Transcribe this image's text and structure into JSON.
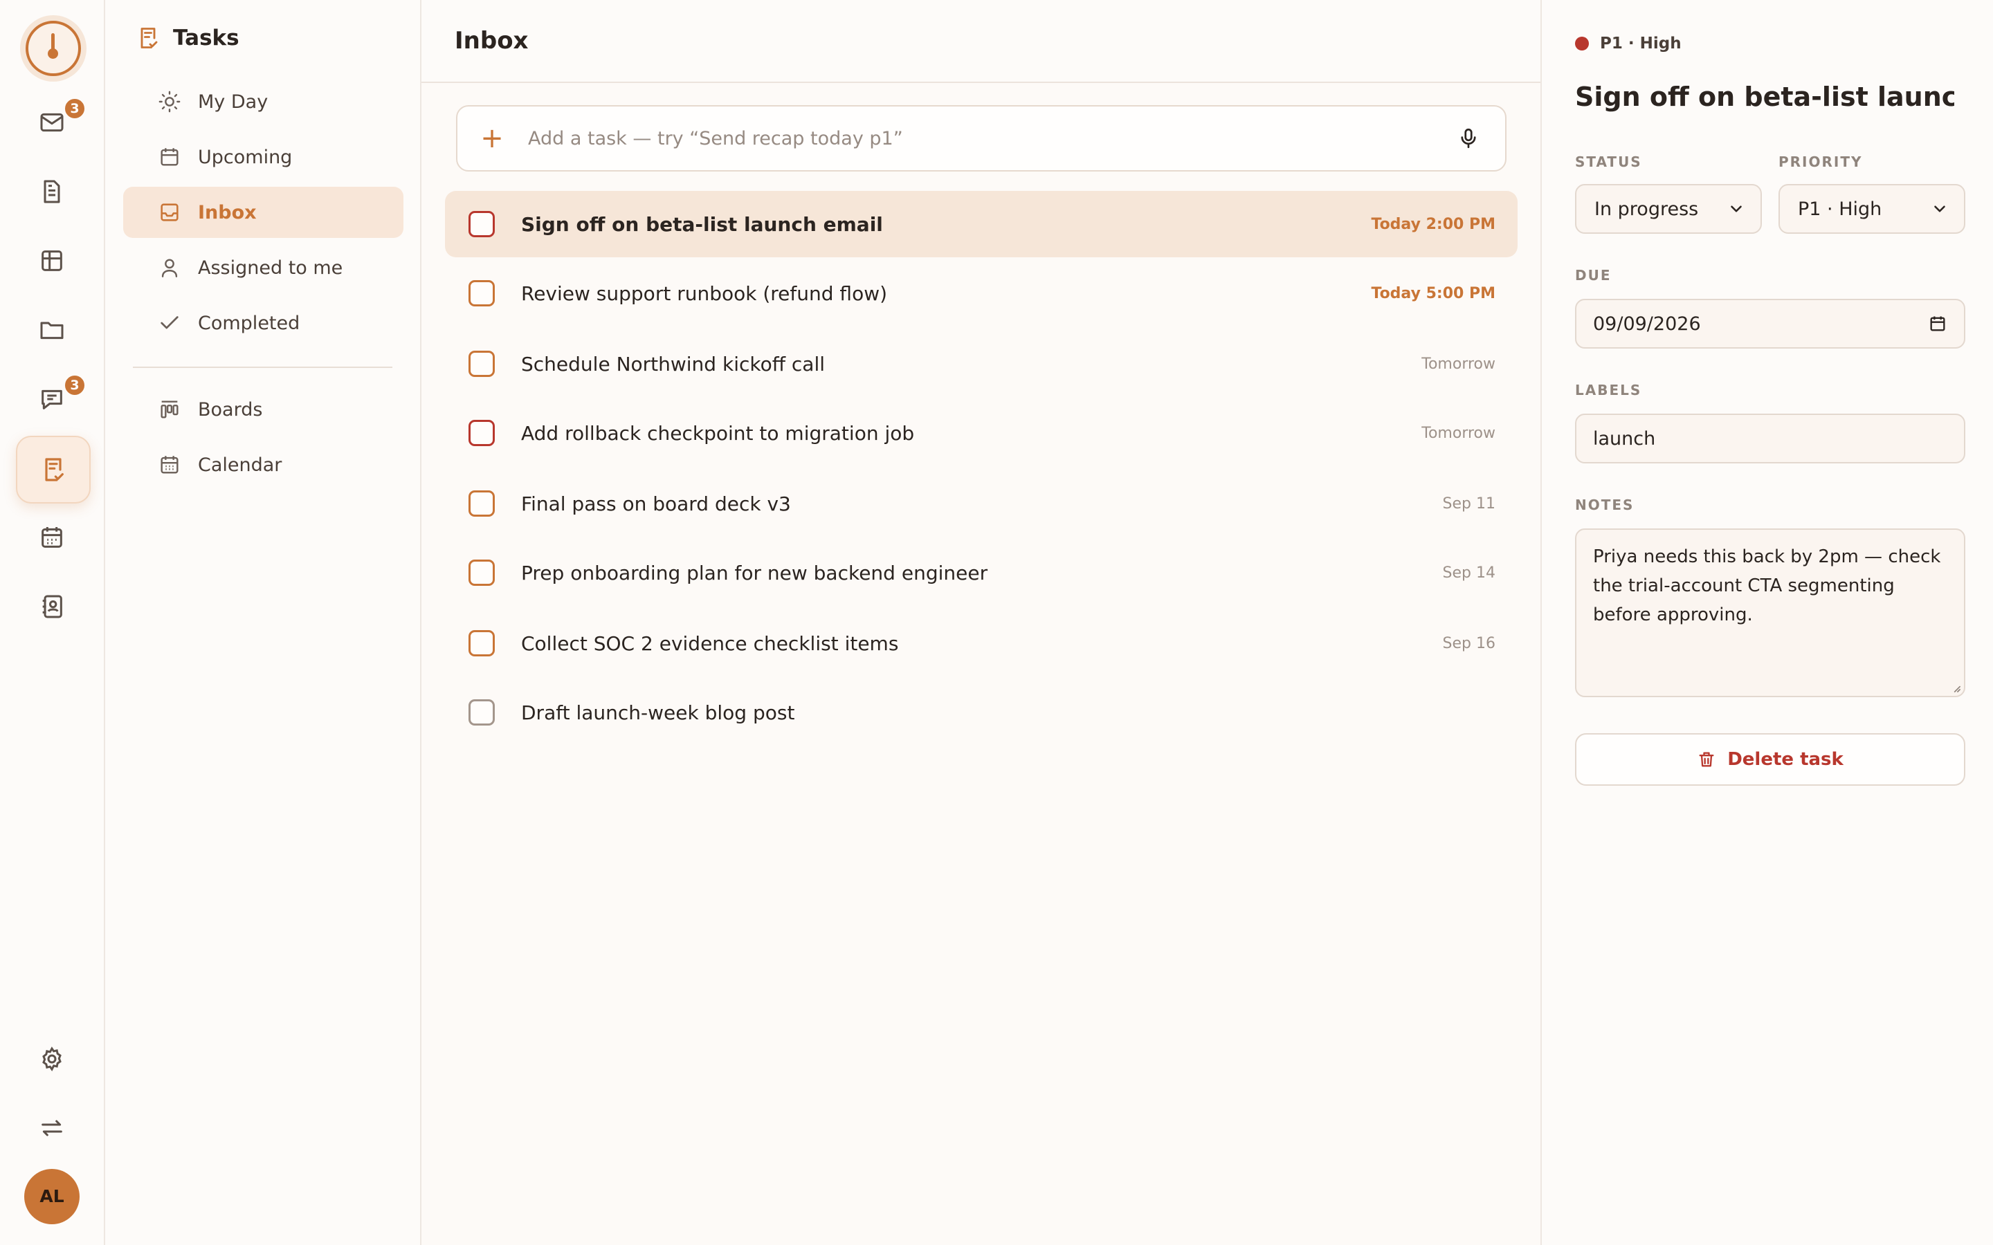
{
  "rail": {
    "badges": {
      "mail": "3",
      "chat": "3"
    },
    "avatar_initials": "AL"
  },
  "nav": {
    "title": "Tasks",
    "items": [
      {
        "label": "My Day",
        "icon": "sun-icon"
      },
      {
        "label": "Upcoming",
        "icon": "calendar-icon"
      },
      {
        "label": "Inbox",
        "icon": "inbox-icon"
      },
      {
        "label": "Assigned to me",
        "icon": "person-icon"
      },
      {
        "label": "Completed",
        "icon": "check-icon"
      }
    ],
    "secondary": [
      {
        "label": "Boards",
        "icon": "board-icon"
      },
      {
        "label": "Calendar",
        "icon": "calendar-grid-icon"
      }
    ]
  },
  "main": {
    "title": "Inbox",
    "add_placeholder": "Add a task — try “Send recap today p1”",
    "tasks": [
      {
        "title": "Sign off on beta-list launch email",
        "due": "Today 2:00 PM",
        "priority": "p1"
      },
      {
        "title": "Review support runbook (refund flow)",
        "due": "Today 5:00 PM",
        "priority": "p2"
      },
      {
        "title": "Schedule Northwind kickoff call",
        "due": "Tomorrow",
        "priority": "p2"
      },
      {
        "title": "Add rollback checkpoint to migration job",
        "due": "Tomorrow",
        "priority": "p1"
      },
      {
        "title": "Final pass on board deck v3",
        "due": "Sep 11",
        "priority": "p2"
      },
      {
        "title": "Prep onboarding plan for new backend engineer",
        "due": "Sep 14",
        "priority": "p2"
      },
      {
        "title": "Collect SOC 2 evidence checklist items",
        "due": "Sep 16",
        "priority": "p2"
      },
      {
        "title": "Draft launch-week blog post",
        "due": "",
        "priority": "p4"
      }
    ]
  },
  "detail": {
    "priority_badge": "P1 · High",
    "title": "Sign off on beta-list launch email",
    "status_label": "STATUS",
    "status_value": "In progress",
    "priority_label": "PRIORITY",
    "priority_value": "P1 · High",
    "due_label": "DUE",
    "due_value": "09/09/2026",
    "labels_label": "LABELS",
    "labels_value": "launch",
    "notes_label": "NOTES",
    "notes_value": "Priya needs this back by 2pm — check the trial-account CTA segmenting before approving.",
    "delete_label": "Delete task"
  },
  "colors": {
    "accent": "#c97536",
    "priority_high": "#b8372d",
    "selected_row": "#f6e6d8"
  }
}
